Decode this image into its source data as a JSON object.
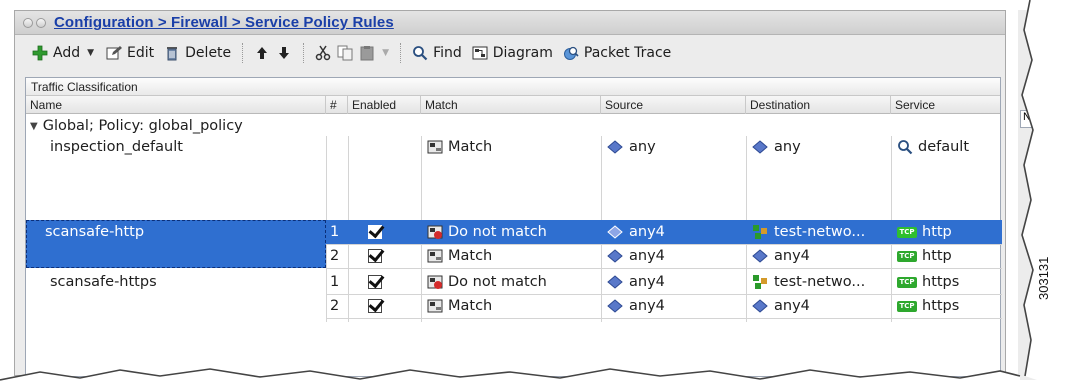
{
  "window": {
    "breadcrumb": "Configuration > Firewall > Service Policy Rules"
  },
  "toolbar": {
    "add_label": "Add",
    "edit_label": "Edit",
    "delete_label": "Delete",
    "find_label": "Find",
    "diagram_label": "Diagram",
    "packet_trace_label": "Packet Trace",
    "icons": [
      "add-icon",
      "edit-icon",
      "delete-icon",
      "move-up-icon",
      "move-down-icon",
      "cut-icon",
      "copy-icon",
      "paste-icon",
      "find-icon",
      "diagram-icon",
      "packet-trace-icon"
    ]
  },
  "table": {
    "group_header": "Traffic Classification",
    "columns": [
      "Name",
      "#",
      "Enabled",
      "Match",
      "Source",
      "Destination",
      "Service"
    ],
    "policy_group": "Global; Policy: global_policy",
    "rows": [
      {
        "name": "inspection_default",
        "num": "",
        "enabled": false,
        "match": "Match",
        "source": "any",
        "destination": "any",
        "service": "default",
        "selected": false
      },
      {
        "name": "scansafe-http",
        "num": "1",
        "enabled": true,
        "match": "Do not match",
        "source": "any4",
        "destination": "test-netwo...",
        "service": "http",
        "selected": true
      },
      {
        "name": "",
        "num": "2",
        "enabled": true,
        "match": "Match",
        "source": "any4",
        "destination": "any4",
        "service": "http",
        "selected": false
      },
      {
        "name": "scansafe-https",
        "num": "1",
        "enabled": true,
        "match": "Do not match",
        "source": "any4",
        "destination": "test-netwo...",
        "service": "https",
        "selected": false
      },
      {
        "name": "",
        "num": "2",
        "enabled": true,
        "match": "Match",
        "source": "any4",
        "destination": "any4",
        "service": "https",
        "selected": false
      }
    ]
  },
  "figure_id": "303131",
  "colors": {
    "selection": "#2f6fd0",
    "link": "#1a3fa8",
    "service_badge": "#2ea82e"
  }
}
